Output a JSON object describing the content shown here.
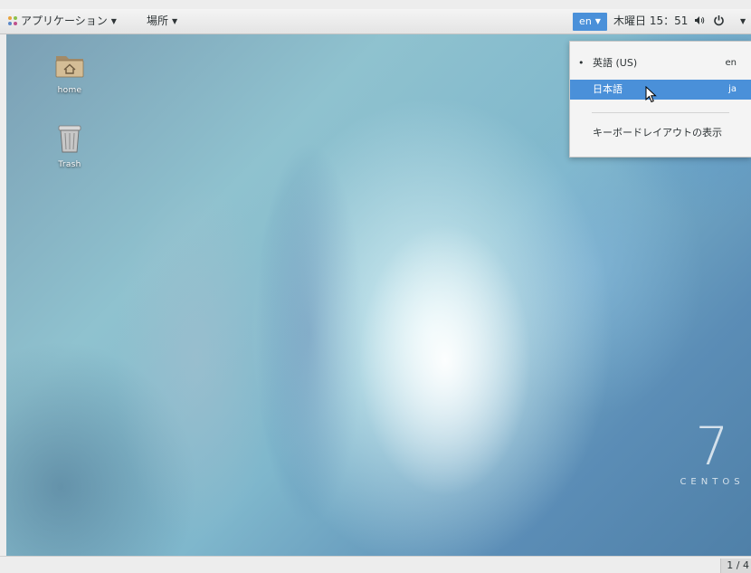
{
  "topbar": {
    "applications_label": "アプリケーション",
    "places_label": "場所",
    "language_indicator": "en",
    "clock": "木曜日 15：51",
    "icons": [
      "applications-icon",
      "volume-icon",
      "power-icon"
    ]
  },
  "desktop": {
    "icons": [
      {
        "label": "home",
        "icon": "home-folder-icon"
      },
      {
        "label": "Trash",
        "icon": "trash-icon"
      }
    ],
    "branding": {
      "number": "7",
      "word": "CENTOS"
    }
  },
  "language_menu": {
    "items": [
      {
        "marker": "•",
        "name": "英語 (US)",
        "code": "en",
        "active": true
      },
      {
        "marker": "",
        "name": "日本語",
        "code": "ja",
        "highlighted": true
      }
    ],
    "show_layout_label": "キーボードレイアウトの表示"
  },
  "bottombar": {
    "workspace": "1 / 4"
  },
  "colors": {
    "highlight": "#4a90d9",
    "topbar_bg": "#ececec"
  }
}
